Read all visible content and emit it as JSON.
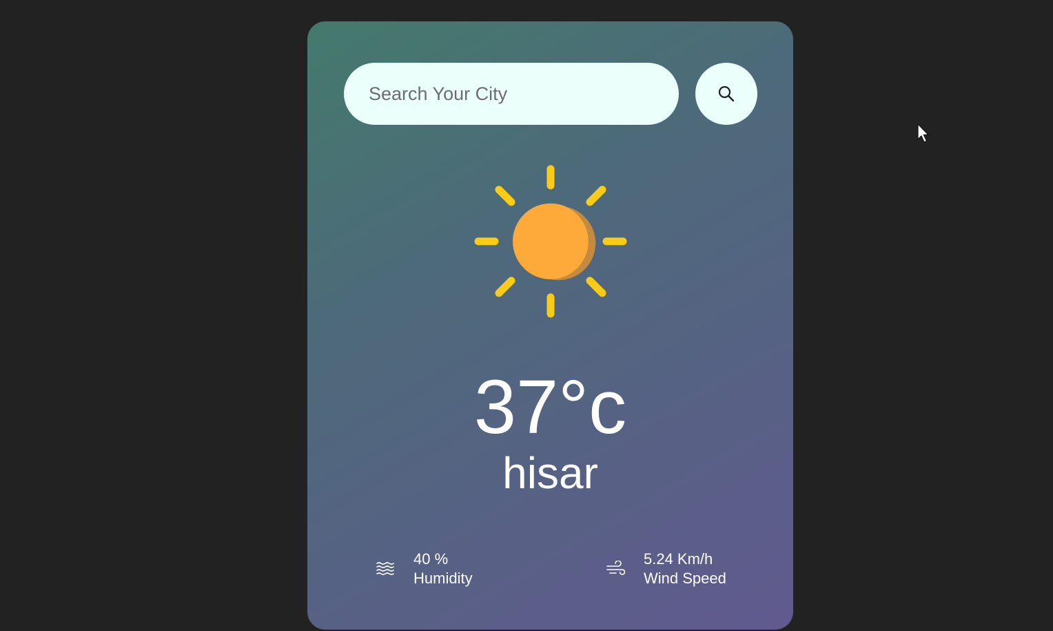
{
  "search": {
    "placeholder": "Search Your City",
    "value": ""
  },
  "weather": {
    "icon": "sun-icon",
    "temperature": "37°c",
    "city": "hisar"
  },
  "details": {
    "humidity": {
      "icon": "humidity-icon",
      "value": "40 %",
      "label": "Humidity"
    },
    "wind": {
      "icon": "wind-icon",
      "value": "5.24 Km/h",
      "label": "Wind Speed"
    }
  },
  "colors": {
    "background": "#222222",
    "card_gradient_start": "#447a6c",
    "card_gradient_end": "#615a8f",
    "search_bg": "#ebfffb",
    "sun_core": "#fdaa3a",
    "sun_rays": "#fbcc17",
    "text": "#ffffff"
  }
}
